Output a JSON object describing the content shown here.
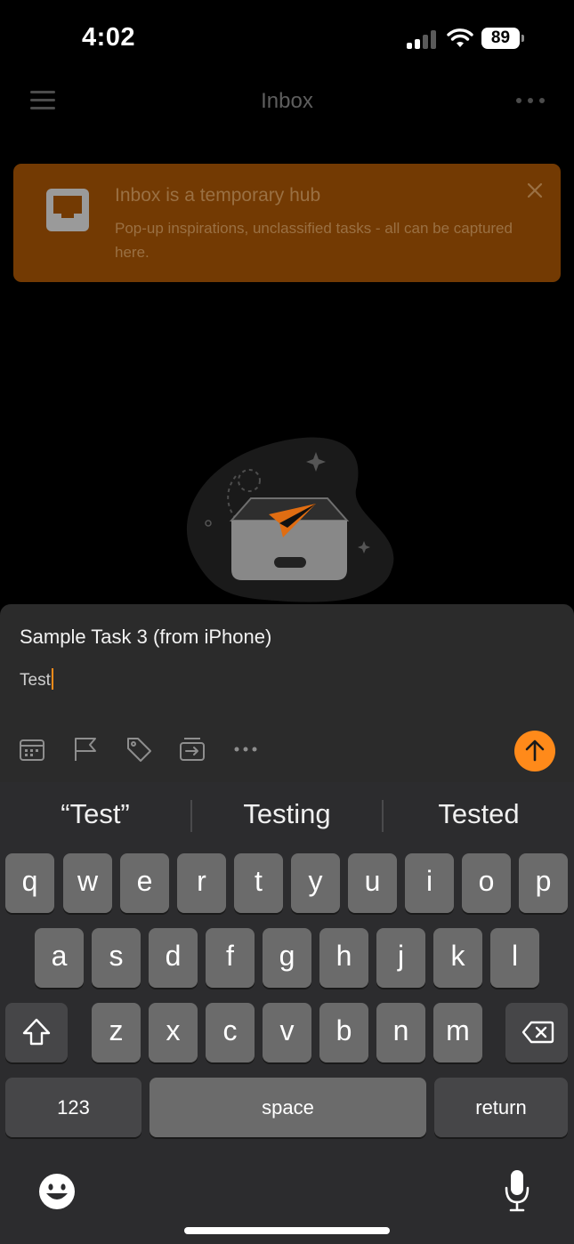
{
  "status_bar": {
    "time": "4:02",
    "battery": "89"
  },
  "header": {
    "title": "Inbox"
  },
  "banner": {
    "title": "Inbox is a temporary hub",
    "text": "Pop-up inspirations, unclassified tasks - all can be captured here."
  },
  "compose": {
    "task_title": "Sample Task 3 (from iPhone)",
    "description": "Test"
  },
  "keyboard": {
    "suggestions": [
      "“Test”",
      "Testing",
      "Tested"
    ],
    "row1": [
      "q",
      "w",
      "e",
      "r",
      "t",
      "y",
      "u",
      "i",
      "o",
      "p"
    ],
    "row2": [
      "a",
      "s",
      "d",
      "f",
      "g",
      "h",
      "j",
      "k",
      "l"
    ],
    "row3": [
      "z",
      "x",
      "c",
      "v",
      "b",
      "n",
      "m"
    ],
    "numbers_label": "123",
    "space_label": "space",
    "return_label": "return"
  },
  "colors": {
    "accent": "#ff8a1a",
    "banner_bg": "#733a03"
  }
}
